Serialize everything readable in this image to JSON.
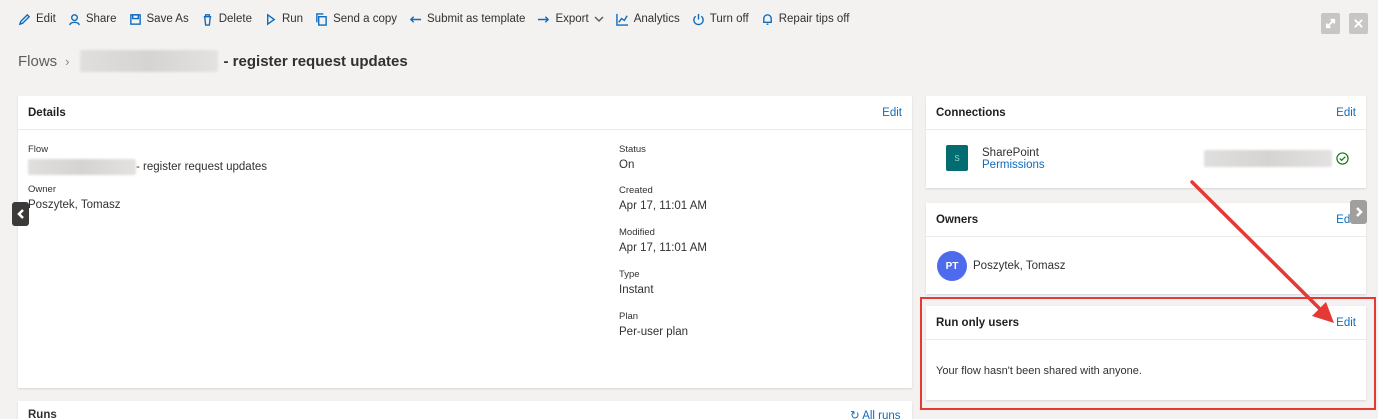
{
  "toolbar": {
    "items": [
      {
        "label": "Edit",
        "icon": "pencil-icon"
      },
      {
        "label": "Share",
        "icon": "share-icon"
      },
      {
        "label": "Save As",
        "icon": "save-as-icon"
      },
      {
        "label": "Delete",
        "icon": "trash-icon"
      },
      {
        "label": "Run",
        "icon": "play-icon"
      },
      {
        "label": "Send a copy",
        "icon": "copy-icon"
      },
      {
        "label": "Submit as template",
        "icon": "submit-icon"
      },
      {
        "label": "Export",
        "icon": "export-icon"
      },
      {
        "label": "Analytics",
        "icon": "chart-icon"
      },
      {
        "label": "Turn off",
        "icon": "power-icon"
      },
      {
        "label": "Repair tips off",
        "icon": "bell-icon"
      }
    ]
  },
  "breadcrumb": {
    "root": "Flows",
    "title": "- register request updates"
  },
  "details": {
    "header": "Details",
    "edit": "Edit",
    "flow_label": "Flow",
    "flow_value": "- register request updates",
    "owner_label": "Owner",
    "owner_value": "Poszytek, Tomasz",
    "status_label": "Status",
    "status_value": "On",
    "created_label": "Created",
    "created_value": "Apr 17, 11:01 AM",
    "modified_label": "Modified",
    "modified_value": "Apr 17, 11:01 AM",
    "type_label": "Type",
    "type_value": "Instant",
    "plan_label": "Plan",
    "plan_value": "Per-user plan"
  },
  "connections": {
    "header": "Connections",
    "edit": "Edit",
    "name": "SharePoint",
    "permissions": "Permissions"
  },
  "owners": {
    "header": "Owners",
    "edit": "Edit",
    "initials": "PT",
    "name": "Poszytek, Tomasz"
  },
  "run_only": {
    "header": "Run only users",
    "edit": "Edit",
    "message": "Your flow hasn't been shared with anyone."
  },
  "runs": {
    "header": "Runs",
    "all_runs": "All runs"
  },
  "colors": {
    "accent": "#0f6cbd",
    "highlight": "#e53935",
    "avatar": "#4f6bed",
    "sharepoint": "#036c70",
    "connected": "#107c10"
  }
}
